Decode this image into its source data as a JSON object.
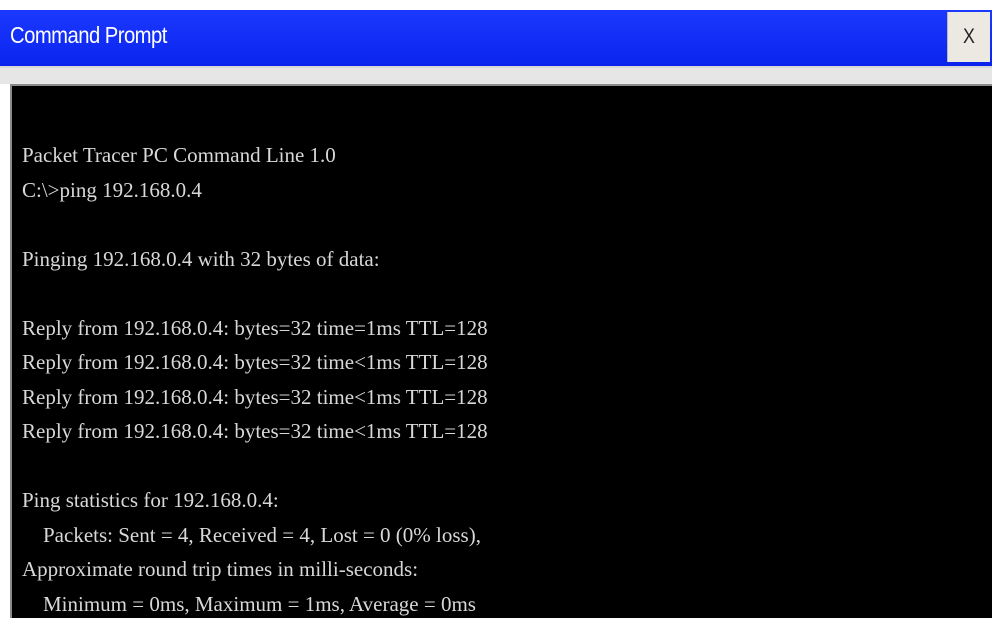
{
  "window": {
    "title": "Command Prompt",
    "close_label": "X"
  },
  "console": {
    "lines": [
      "Packet Tracer PC Command Line 1.0",
      "C:\\>ping 192.168.0.4",
      "",
      "Pinging 192.168.0.4 with 32 bytes of data:",
      "",
      "Reply from 192.168.0.4: bytes=32 time=1ms TTL=128",
      "Reply from 192.168.0.4: bytes=32 time<1ms TTL=128",
      "Reply from 192.168.0.4: bytes=32 time<1ms TTL=128",
      "Reply from 192.168.0.4: bytes=32 time<1ms TTL=128",
      "",
      "Ping statistics for 192.168.0.4:",
      "    Packets: Sent = 4, Received = 4, Lost = 0 (0% loss),",
      "Approximate round trip times in milli-seconds:",
      "    Minimum = 0ms, Maximum = 1ms, Average = 0ms"
    ]
  },
  "colors": {
    "titlebar": "#0a24ee",
    "console_background": "#000000",
    "console_text": "#d8d8d8"
  }
}
